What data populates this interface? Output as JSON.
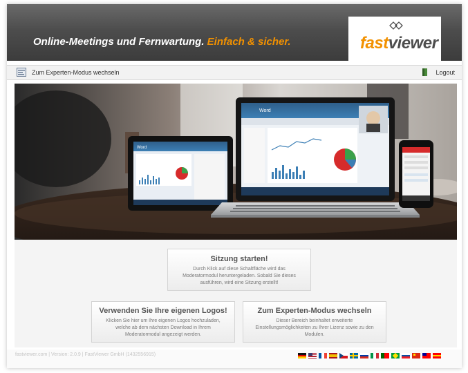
{
  "header": {
    "tagline_main": "Online-Meetings und Fernwartung.",
    "tagline_accent": "Einfach & sicher.",
    "logo_light": "fast",
    "logo_dark": "viewer"
  },
  "toolbar": {
    "expert_mode_label": "Zum Experten-Modus wechseln",
    "logout_label": "Logout"
  },
  "hero": {
    "laptop_window_title": "Word",
    "tablet_window_title": "Word"
  },
  "cards": {
    "start_title": "Sitzung starten!",
    "start_desc": "Durch Klick auf diese Schaltfläche wird das Moderatormodul heruntergeladen. Sobald Sie dieses ausführen, wird eine Sitzung erstellt!",
    "logo_title": "Verwenden Sie Ihre eigenen Logos!",
    "logo_desc": "Klicken Sie hier um Ihre eigenen Logos hochzuladen, welche ab dem nächsten Download in Ihrem Moderatormodul angezeigt werden.",
    "expert_title": "Zum Experten-Modus wechseln",
    "expert_desc": "Dieser Bereich beinhaltet erweiterte Einstellungsmöglichkeiten zu Ihrer Lizenz sowie zu den Modulen."
  },
  "footer": {
    "text": "fastviewer.com | Version: 2.0.9 | FastViewer GmbH (1432556915)"
  },
  "colors": {
    "accent": "#f29100",
    "header_dark": "#3c3c3c"
  },
  "icons": {
    "toolbar_left": "expert-mode-icon",
    "toolbar_right": "logout-icon",
    "logo_mark": "fastviewer-mark-icon"
  },
  "languages": [
    "de",
    "en",
    "fr",
    "es",
    "cz",
    "se",
    "ru",
    "it",
    "pt",
    "br",
    "sk",
    "cn",
    "tw",
    "hr"
  ]
}
